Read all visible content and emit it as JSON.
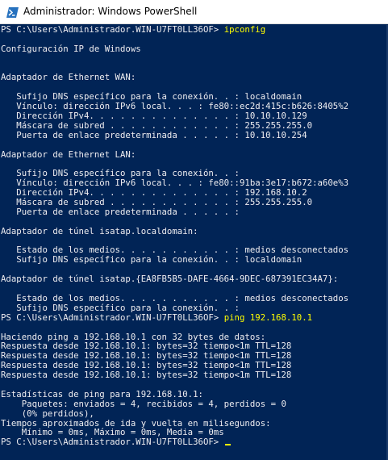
{
  "window": {
    "title": "Administrador: Windows PowerShell"
  },
  "colors": {
    "console_background": "#012456",
    "console_text": "#eeedf0",
    "command_text": "#ffff00"
  },
  "console": {
    "lines": [
      {
        "text": "PS C:\\Users\\Administrador.WIN-U7FT0LL36OF> ",
        "command": "ipconfig"
      },
      {
        "text": ""
      },
      {
        "text": "Configuración IP de Windows"
      },
      {
        "text": ""
      },
      {
        "text": ""
      },
      {
        "text": "Adaptador de Ethernet WAN:"
      },
      {
        "text": ""
      },
      {
        "text": "   Sufijo DNS específico para la conexión. . : localdomain"
      },
      {
        "text": "   Vínculo: dirección IPv6 local. . . : fe80::ec2d:415c:b626:8405%2"
      },
      {
        "text": "   Dirección IPv4. . . . . . . . . . . . . . : 10.10.10.129"
      },
      {
        "text": "   Máscara de subred . . . . . . . . . . . . : 255.255.255.0"
      },
      {
        "text": "   Puerta de enlace predeterminada . . . . . : 10.10.10.254"
      },
      {
        "text": ""
      },
      {
        "text": "Adaptador de Ethernet LAN:"
      },
      {
        "text": ""
      },
      {
        "text": "   Sufijo DNS específico para la conexión. . :"
      },
      {
        "text": "   Vínculo: dirección IPv6 local. . . : fe80::91ba:3e17:b672:a60e%3"
      },
      {
        "text": "   Dirección IPv4. . . . . . . . . . . . . . : 192.168.10.2"
      },
      {
        "text": "   Máscara de subred . . . . . . . . . . . . : 255.255.255.0"
      },
      {
        "text": "   Puerta de enlace predeterminada . . . . . :"
      },
      {
        "text": ""
      },
      {
        "text": "Adaptador de túnel isatap.localdomain:"
      },
      {
        "text": ""
      },
      {
        "text": "   Estado de los medios. . . . . . . . . . . : medios desconectados"
      },
      {
        "text": "   Sufijo DNS específico para la conexión. . : localdomain"
      },
      {
        "text": ""
      },
      {
        "text": "Adaptador de túnel isatap.{EA8FB5B5-DAFE-4664-9DEC-687391EC34A7}:"
      },
      {
        "text": ""
      },
      {
        "text": "   Estado de los medios. . . . . . . . . . . : medios desconectados"
      },
      {
        "text": "   Sufijo DNS específico para la conexión. . :"
      },
      {
        "text": "PS C:\\Users\\Administrador.WIN-U7FT0LL36OF> ",
        "command": "ping 192.168.10.1"
      },
      {
        "text": ""
      },
      {
        "text": "Haciendo ping a 192.168.10.1 con 32 bytes de datos:"
      },
      {
        "text": "Respuesta desde 192.168.10.1: bytes=32 tiempo<1m TTL=128"
      },
      {
        "text": "Respuesta desde 192.168.10.1: bytes=32 tiempo<1m TTL=128"
      },
      {
        "text": "Respuesta desde 192.168.10.1: bytes=32 tiempo<1m TTL=128"
      },
      {
        "text": "Respuesta desde 192.168.10.1: bytes=32 tiempo<1m TTL=128"
      },
      {
        "text": ""
      },
      {
        "text": "Estadísticas de ping para 192.168.10.1:"
      },
      {
        "text": "    Paquetes: enviados = 4, recibidos = 4, perdidos = 0"
      },
      {
        "text": "    (0% perdidos),"
      },
      {
        "text": "Tiempos aproximados de ida y vuelta en milisegundos:"
      },
      {
        "text": "    Mínimo = 0ms, Máximo = 0ms, Media = 0ms"
      },
      {
        "text": "PS C:\\Users\\Administrador.WIN-U7FT0LL36OF> ",
        "command": "",
        "cursor": true
      }
    ]
  }
}
